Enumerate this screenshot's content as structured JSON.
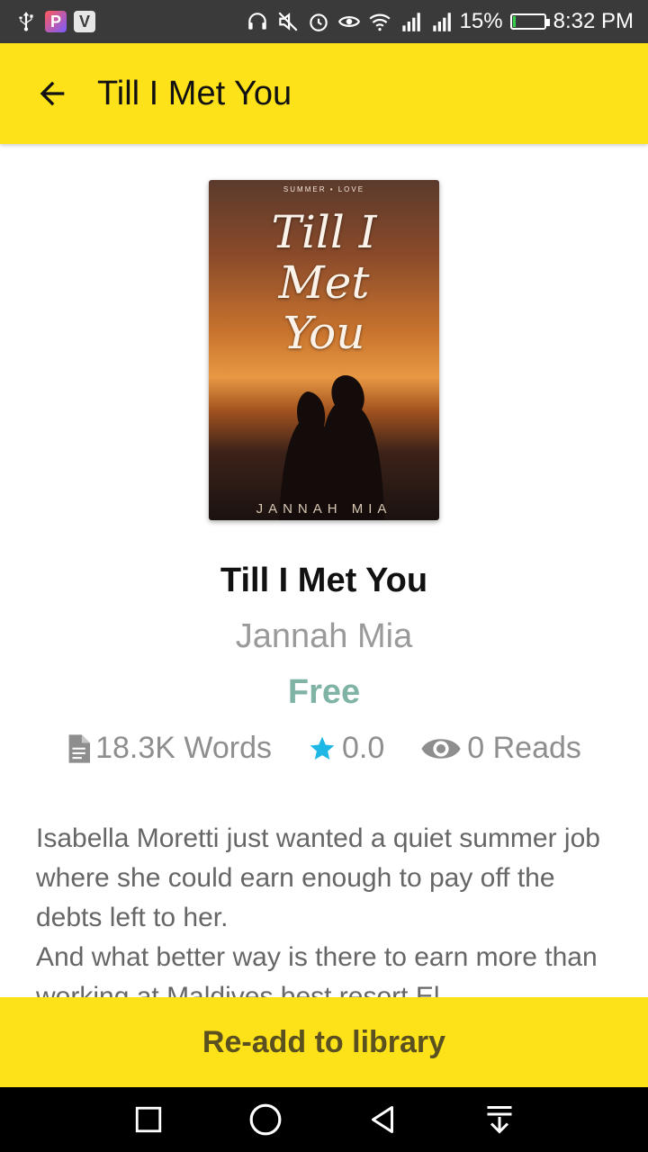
{
  "status_bar": {
    "battery": "15%",
    "time": "8:32 PM",
    "battery_level": 0.15,
    "icons": [
      "usb-icon",
      "p-app-icon",
      "v-app-icon",
      "headset-icon",
      "mute-icon",
      "alarm-icon",
      "eye-icon",
      "wifi-icon",
      "signal-icon",
      "signal-icon",
      "battery-icon"
    ],
    "app_badges": {
      "p": "P",
      "v": "V"
    }
  },
  "app_bar": {
    "title": "Till I Met You",
    "color": "#fde219"
  },
  "book": {
    "cover": {
      "series": "SUMMER • LOVE",
      "title_line1": "Till I",
      "title_line2": "Met",
      "title_line3": "You",
      "author": "JANNAH MIA"
    },
    "title": "Till I Met You",
    "author": "Jannah Mia",
    "price": "Free",
    "price_color": "#7fb3a5",
    "words": "18.3K Words",
    "rating": "0.0",
    "reads": "0 Reads",
    "star_color": "#1fb8e6",
    "description": "Isabella Moretti just wanted a quiet summer job where she could earn enough to pay off the debts left to her.\nAnd what better way is there to earn more than working at Maldives best resort El"
  },
  "actions": {
    "readd_label": "Re-add to library"
  }
}
